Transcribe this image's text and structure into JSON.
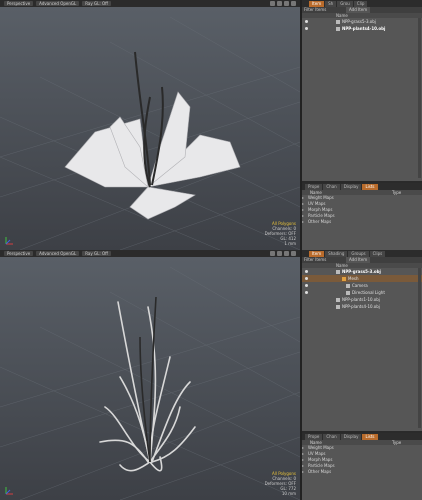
{
  "viewports": [
    {
      "toolbar": [
        "Perspective",
        "Advanced OpenGL",
        "Ray GL: Off"
      ],
      "info": {
        "selection": "All Polygons",
        "channels": "Channels: 0",
        "deformers": "Deformers: OFF",
        "gl": "GL: 412",
        "unit": "1 mm"
      }
    },
    {
      "toolbar": [
        "Perspective",
        "Advanced OpenGL",
        "Ray GL: Off"
      ],
      "info": {
        "selection": "All Polygons",
        "channels": "Channels: 0",
        "deformers": "Deformers: OFF",
        "gl": "GL: 772",
        "unit": "10 mm"
      }
    }
  ],
  "panels": [
    {
      "tabs": [
        "Item",
        "Sh",
        "Grou",
        "Clip"
      ],
      "filter_label": "Filter Items",
      "add_item": "Add Item",
      "name_header": "Name",
      "items": [
        {
          "label": "NPP-grass5-3.obj",
          "bold": false
        },
        {
          "label": "NPP-plants4-10.obj",
          "bold": true
        }
      ],
      "vmap": {
        "tabs": [
          "Prope",
          "Chan",
          "Display",
          "Lists"
        ],
        "name_header": "Name",
        "type_header": "Type",
        "items": [
          "Weight Maps",
          "UV Maps",
          "Morph Maps",
          "Particle Maps",
          "Other Maps"
        ]
      }
    },
    {
      "tabs": [
        "Item",
        "Shading",
        "Groups",
        "Clips"
      ],
      "filter_label": "Filter Items",
      "add_item": "Add Item",
      "name_header": "Name",
      "items": [
        {
          "label": "NPP-grass5-3.obj",
          "bold": true
        },
        {
          "label": "Mesh",
          "bold": false,
          "selected": true
        },
        {
          "label": "Camera",
          "bold": false
        },
        {
          "label": "Directional Light",
          "bold": false
        },
        {
          "label": "NPP-plants1-10.obj",
          "bold": false
        },
        {
          "label": "NPP-plants4-10.obj",
          "bold": false
        }
      ],
      "vmap": {
        "tabs": [
          "Prope",
          "Chan",
          "Display",
          "Lists"
        ],
        "name_header": "Name",
        "type_header": "Type",
        "items": [
          "Weight Maps",
          "UV Maps",
          "Morph Maps",
          "Particle Maps",
          "Other Maps"
        ]
      }
    }
  ]
}
